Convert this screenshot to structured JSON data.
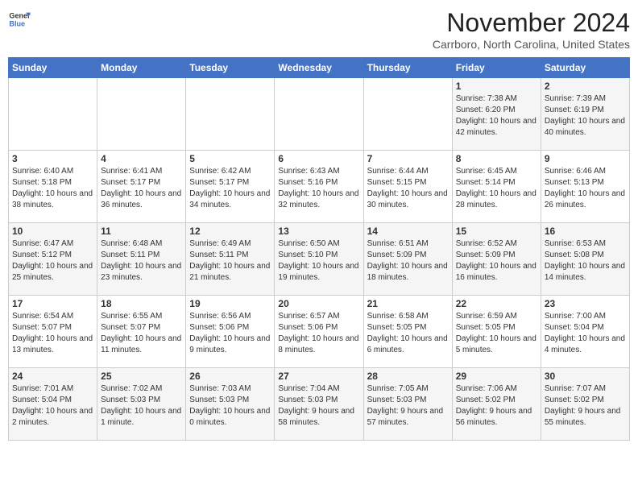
{
  "header": {
    "logo_line1": "General",
    "logo_line2": "Blue",
    "month_title": "November 2024",
    "location": "Carrboro, North Carolina, United States"
  },
  "weekdays": [
    "Sunday",
    "Monday",
    "Tuesday",
    "Wednesday",
    "Thursday",
    "Friday",
    "Saturday"
  ],
  "weeks": [
    [
      {
        "day": "",
        "info": ""
      },
      {
        "day": "",
        "info": ""
      },
      {
        "day": "",
        "info": ""
      },
      {
        "day": "",
        "info": ""
      },
      {
        "day": "",
        "info": ""
      },
      {
        "day": "1",
        "info": "Sunrise: 7:38 AM\nSunset: 6:20 PM\nDaylight: 10 hours and 42 minutes."
      },
      {
        "day": "2",
        "info": "Sunrise: 7:39 AM\nSunset: 6:19 PM\nDaylight: 10 hours and 40 minutes."
      }
    ],
    [
      {
        "day": "3",
        "info": "Sunrise: 6:40 AM\nSunset: 5:18 PM\nDaylight: 10 hours and 38 minutes."
      },
      {
        "day": "4",
        "info": "Sunrise: 6:41 AM\nSunset: 5:17 PM\nDaylight: 10 hours and 36 minutes."
      },
      {
        "day": "5",
        "info": "Sunrise: 6:42 AM\nSunset: 5:17 PM\nDaylight: 10 hours and 34 minutes."
      },
      {
        "day": "6",
        "info": "Sunrise: 6:43 AM\nSunset: 5:16 PM\nDaylight: 10 hours and 32 minutes."
      },
      {
        "day": "7",
        "info": "Sunrise: 6:44 AM\nSunset: 5:15 PM\nDaylight: 10 hours and 30 minutes."
      },
      {
        "day": "8",
        "info": "Sunrise: 6:45 AM\nSunset: 5:14 PM\nDaylight: 10 hours and 28 minutes."
      },
      {
        "day": "9",
        "info": "Sunrise: 6:46 AM\nSunset: 5:13 PM\nDaylight: 10 hours and 26 minutes."
      }
    ],
    [
      {
        "day": "10",
        "info": "Sunrise: 6:47 AM\nSunset: 5:12 PM\nDaylight: 10 hours and 25 minutes."
      },
      {
        "day": "11",
        "info": "Sunrise: 6:48 AM\nSunset: 5:11 PM\nDaylight: 10 hours and 23 minutes."
      },
      {
        "day": "12",
        "info": "Sunrise: 6:49 AM\nSunset: 5:11 PM\nDaylight: 10 hours and 21 minutes."
      },
      {
        "day": "13",
        "info": "Sunrise: 6:50 AM\nSunset: 5:10 PM\nDaylight: 10 hours and 19 minutes."
      },
      {
        "day": "14",
        "info": "Sunrise: 6:51 AM\nSunset: 5:09 PM\nDaylight: 10 hours and 18 minutes."
      },
      {
        "day": "15",
        "info": "Sunrise: 6:52 AM\nSunset: 5:09 PM\nDaylight: 10 hours and 16 minutes."
      },
      {
        "day": "16",
        "info": "Sunrise: 6:53 AM\nSunset: 5:08 PM\nDaylight: 10 hours and 14 minutes."
      }
    ],
    [
      {
        "day": "17",
        "info": "Sunrise: 6:54 AM\nSunset: 5:07 PM\nDaylight: 10 hours and 13 minutes."
      },
      {
        "day": "18",
        "info": "Sunrise: 6:55 AM\nSunset: 5:07 PM\nDaylight: 10 hours and 11 minutes."
      },
      {
        "day": "19",
        "info": "Sunrise: 6:56 AM\nSunset: 5:06 PM\nDaylight: 10 hours and 9 minutes."
      },
      {
        "day": "20",
        "info": "Sunrise: 6:57 AM\nSunset: 5:06 PM\nDaylight: 10 hours and 8 minutes."
      },
      {
        "day": "21",
        "info": "Sunrise: 6:58 AM\nSunset: 5:05 PM\nDaylight: 10 hours and 6 minutes."
      },
      {
        "day": "22",
        "info": "Sunrise: 6:59 AM\nSunset: 5:05 PM\nDaylight: 10 hours and 5 minutes."
      },
      {
        "day": "23",
        "info": "Sunrise: 7:00 AM\nSunset: 5:04 PM\nDaylight: 10 hours and 4 minutes."
      }
    ],
    [
      {
        "day": "24",
        "info": "Sunrise: 7:01 AM\nSunset: 5:04 PM\nDaylight: 10 hours and 2 minutes."
      },
      {
        "day": "25",
        "info": "Sunrise: 7:02 AM\nSunset: 5:03 PM\nDaylight: 10 hours and 1 minute."
      },
      {
        "day": "26",
        "info": "Sunrise: 7:03 AM\nSunset: 5:03 PM\nDaylight: 10 hours and 0 minutes."
      },
      {
        "day": "27",
        "info": "Sunrise: 7:04 AM\nSunset: 5:03 PM\nDaylight: 9 hours and 58 minutes."
      },
      {
        "day": "28",
        "info": "Sunrise: 7:05 AM\nSunset: 5:03 PM\nDaylight: 9 hours and 57 minutes."
      },
      {
        "day": "29",
        "info": "Sunrise: 7:06 AM\nSunset: 5:02 PM\nDaylight: 9 hours and 56 minutes."
      },
      {
        "day": "30",
        "info": "Sunrise: 7:07 AM\nSunset: 5:02 PM\nDaylight: 9 hours and 55 minutes."
      }
    ]
  ]
}
